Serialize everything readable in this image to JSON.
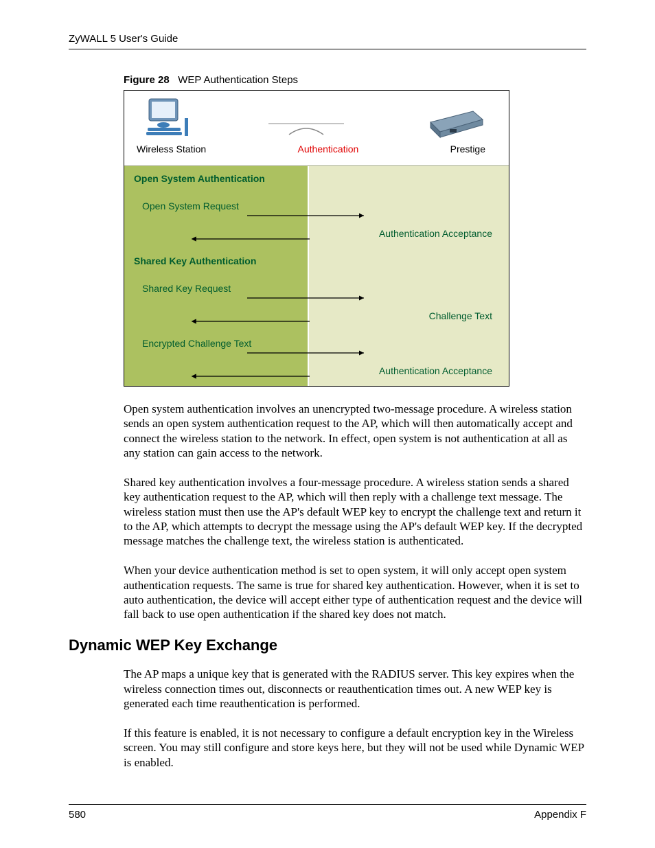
{
  "header": {
    "text": "ZyWALL 5 User's Guide"
  },
  "figure": {
    "label": "Figure 28",
    "title": "WEP Authentication Steps",
    "top_labels": {
      "left": "Wireless Station",
      "center": "Authentication",
      "right": "Prestige"
    },
    "rows": {
      "open_header": "Open System Authentication",
      "open_request": "Open System Request",
      "open_accept": "Authentication Acceptance",
      "shared_header": "Shared Key Authentication",
      "shared_request": "Shared Key Request",
      "challenge_text": "Challenge Text",
      "encrypted_challenge": "Encrypted Challenge Text",
      "shared_accept": "Authentication Acceptance"
    }
  },
  "paragraphs": {
    "p1": "Open system authentication involves an unencrypted two-message procedure. A wireless station sends an open system authentication request to the AP, which will then automatically accept and connect the wireless station to the network. In effect, open system is not authentication at all as any station can gain access to the network.",
    "p2": "Shared key authentication involves a four-message procedure. A wireless station sends a shared key authentication request to the AP, which will then reply with a challenge text message. The wireless station must then use the AP's default WEP key to encrypt the challenge text and return it to the AP, which attempts to decrypt the message using the AP's default WEP key. If the decrypted message matches the challenge text, the wireless station is authenticated.",
    "p3": "When your device authentication method is set to open system, it will only accept open system authentication requests. The same is true for shared key authentication. However, when it is set to auto authentication, the device will accept either type of authentication request and the device will fall back to use open authentication if the shared key does not match."
  },
  "section2": {
    "heading": "Dynamic WEP Key Exchange",
    "p1": "The AP maps a unique key that is generated with the RADIUS server. This key expires when the wireless connection times out, disconnects or reauthentication times out. A new WEP key is generated each time reauthentication is performed.",
    "p2": "If this feature is enabled, it is not necessary to configure a default encryption key in the Wireless screen. You may still configure and store keys here, but they will not be used while Dynamic WEP is enabled."
  },
  "footer": {
    "page": "580",
    "section": "Appendix F"
  }
}
